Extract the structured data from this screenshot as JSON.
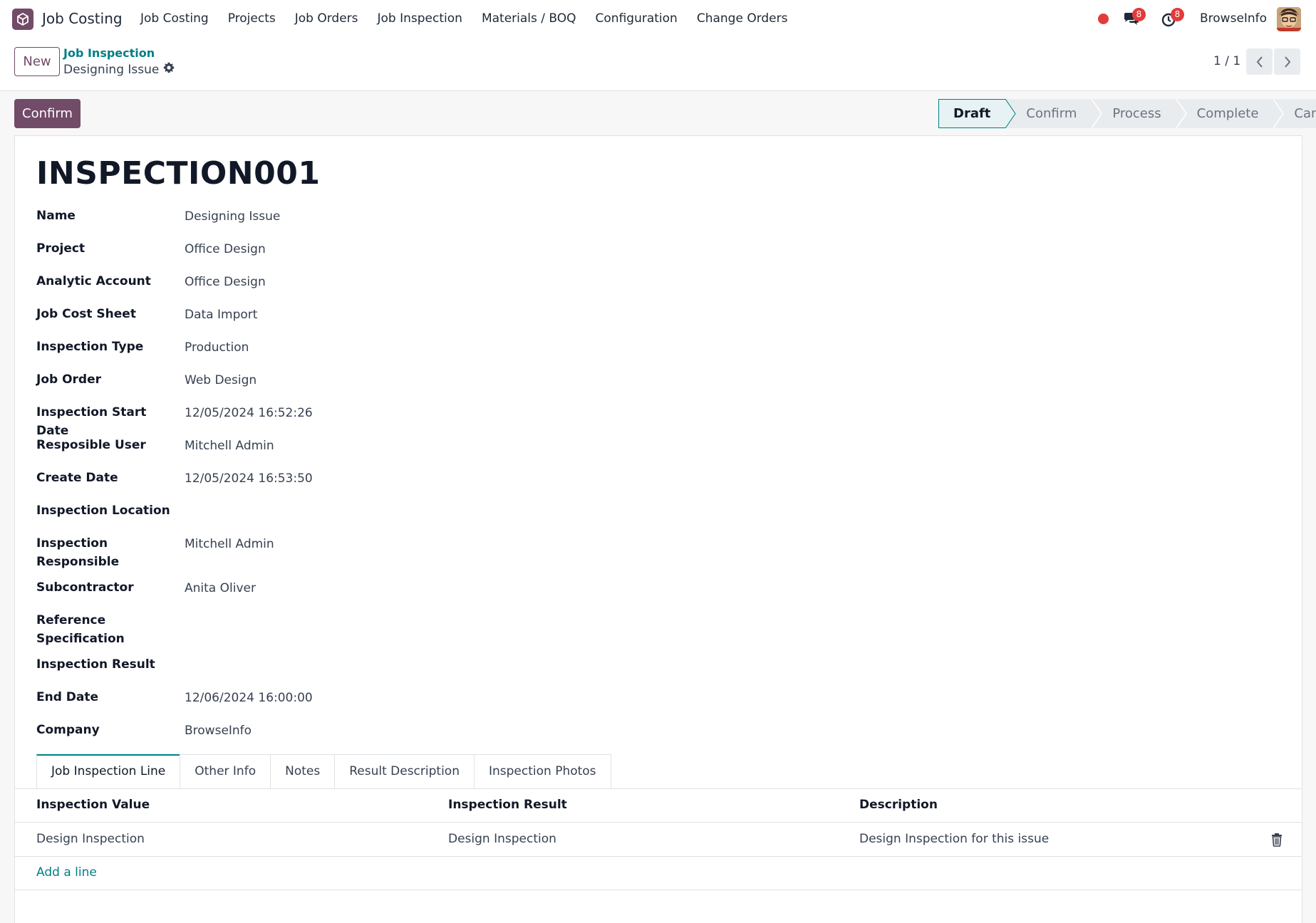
{
  "app": {
    "name": "Job Costing",
    "menu": [
      "Job Costing",
      "Projects",
      "Job Orders",
      "Job Inspection",
      "Materials / BOQ",
      "Configuration",
      "Change Orders"
    ],
    "messages_count": "8",
    "activities_count": "8",
    "company": "BrowseInfo"
  },
  "control": {
    "new_label": "New",
    "breadcrumb_parent": "Job Inspection",
    "breadcrumb_current": "Designing Issue",
    "pager": "1 / 1"
  },
  "actions": {
    "confirm_label": "Confirm",
    "statuses": [
      "Draft",
      "Confirm",
      "Process",
      "Complete",
      "Cancel"
    ],
    "current_status": "Draft"
  },
  "record": {
    "title": "INSPECTION001",
    "fields": [
      {
        "label": "Name",
        "value": "Designing Issue"
      },
      {
        "label": "Project",
        "value": "Office Design"
      },
      {
        "label": "Analytic Account",
        "value": "Office Design"
      },
      {
        "label": "Job Cost Sheet",
        "value": "Data Import"
      },
      {
        "label": "Inspection Type",
        "value": "Production"
      },
      {
        "label": "Job Order",
        "value": "Web Design"
      },
      {
        "label": "Inspection Start Date",
        "value": "12/05/2024 16:52:26"
      },
      {
        "label": "Resposible User",
        "value": "Mitchell Admin"
      },
      {
        "label": "Create Date",
        "value": "12/05/2024 16:53:50"
      },
      {
        "label": "Inspection Location",
        "value": ""
      },
      {
        "label": "Inspection Responsible",
        "value": "Mitchell Admin"
      },
      {
        "label": "Subcontractor",
        "value": "Anita Oliver"
      },
      {
        "label": "Reference Specification",
        "value": ""
      },
      {
        "label": "Inspection Result",
        "value": ""
      },
      {
        "label": "End Date",
        "value": "12/06/2024 16:00:00"
      },
      {
        "label": "Company",
        "value": "BrowseInfo"
      }
    ]
  },
  "tabs": [
    "Job Inspection Line",
    "Other Info",
    "Notes",
    "Result Description",
    "Inspection Photos"
  ],
  "table": {
    "headers": [
      "Inspection Value",
      "Inspection Result",
      "Description"
    ],
    "rows": [
      [
        "Design Inspection",
        "Design Inspection",
        "Design Inspection for this issue"
      ]
    ],
    "add_line_label": "Add a line"
  },
  "colors": {
    "brand": "#714b67",
    "accent": "#017e84",
    "badge": "#e23b3b"
  },
  "icons": [
    "app-logo-icon",
    "recording-dot-icon",
    "chat-icon",
    "clock-icon",
    "gear-icon",
    "chevron-left-icon",
    "chevron-right-icon",
    "trash-icon"
  ]
}
